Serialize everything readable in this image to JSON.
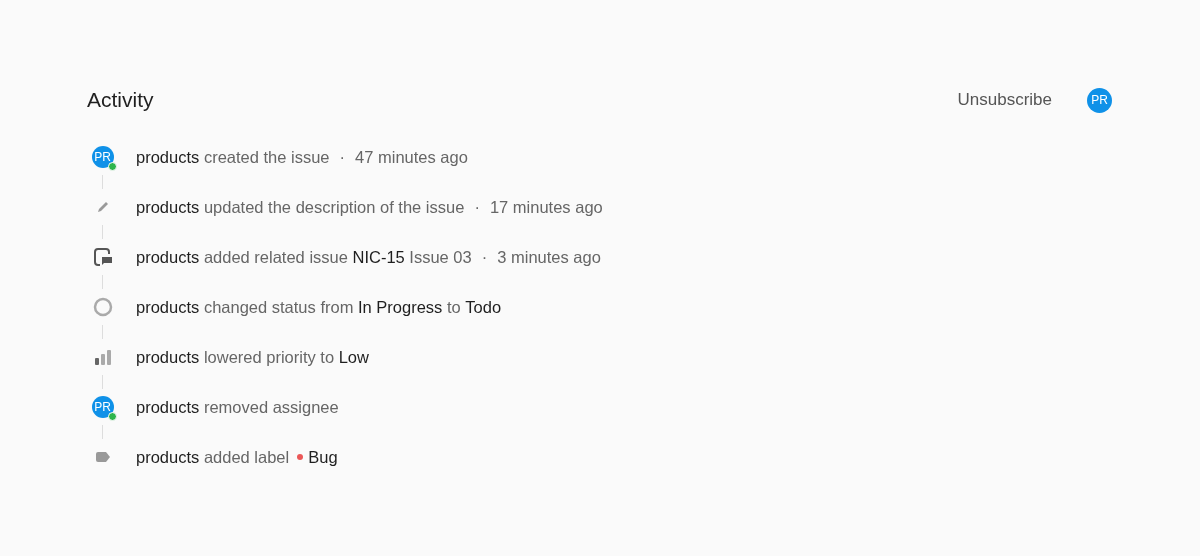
{
  "header": {
    "title": "Activity",
    "unsubscribe": "Unsubscribe",
    "avatar": {
      "initials": "PR"
    }
  },
  "events": [
    {
      "kind": "avatar",
      "initials": "PR",
      "online": true,
      "text": "**products** created the issue",
      "separator": "·",
      "time": "47 minutes ago"
    },
    {
      "kind": "edit",
      "text": "**products** updated the description of the issue",
      "separator": "·",
      "time": "17 minutes ago"
    },
    {
      "kind": "related",
      "text": "**products** added related issue **NIC-15** Issue 03",
      "separator": "·",
      "time": "3 minutes ago"
    },
    {
      "kind": "status",
      "text": "**products** changed status from **In Progress** to **Todo**"
    },
    {
      "kind": "priority",
      "text": "**products** lowered priority to **Low**"
    },
    {
      "kind": "avatar",
      "initials": "PR",
      "online": true,
      "text": "**products** removed assignee"
    },
    {
      "kind": "label",
      "text": "**products** added label",
      "label": {
        "name": "Bug",
        "color": "#eb5757"
      }
    }
  ]
}
